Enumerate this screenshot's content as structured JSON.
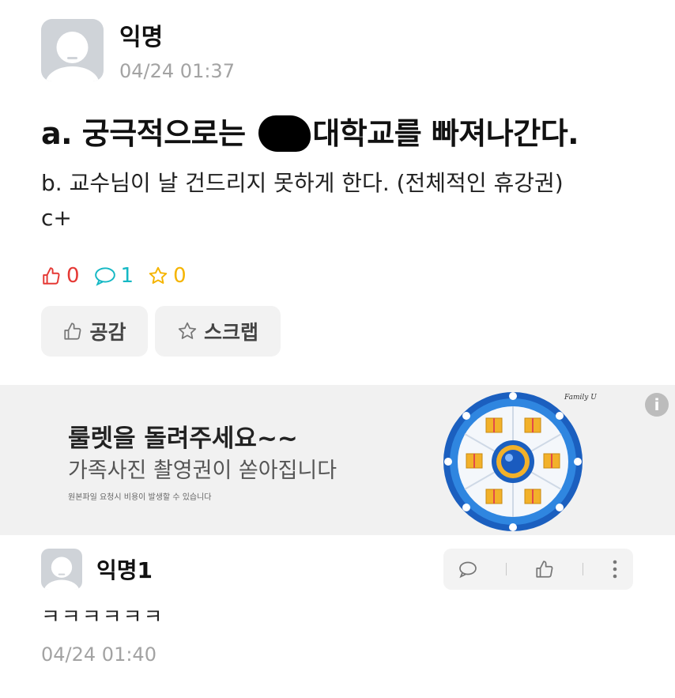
{
  "post": {
    "author": "익명",
    "time": "04/24 01:37",
    "title_before": "a. 궁극적으로는",
    "title_after": "대학교를 빠져나간다.",
    "body_line1": "b. 교수님이 날 건드리지 못하게 한다. (전체적인 휴강권)",
    "body_line2": "c+"
  },
  "stats": {
    "likes": "0",
    "comments": "1",
    "scraps": "0",
    "like_color": "#e53935",
    "comment_color": "#14b8c4",
    "scrap_color": "#f5b400"
  },
  "buttons": {
    "like_label": "공감",
    "scrap_label": "스크랩"
  },
  "ad": {
    "headline": "룰렛을 돌려주세요~~",
    "subline": "가족사진 촬영권이 쏟아집니다",
    "fineprint": "원본파일 요청시 비용이 발생할 수 있습니다",
    "info_label": "i",
    "brand_mark": "Family U"
  },
  "comment": {
    "author": "익명1",
    "text": "ㅋㅋㅋㅋㅋㅋ",
    "time": "04/24 01:40"
  }
}
